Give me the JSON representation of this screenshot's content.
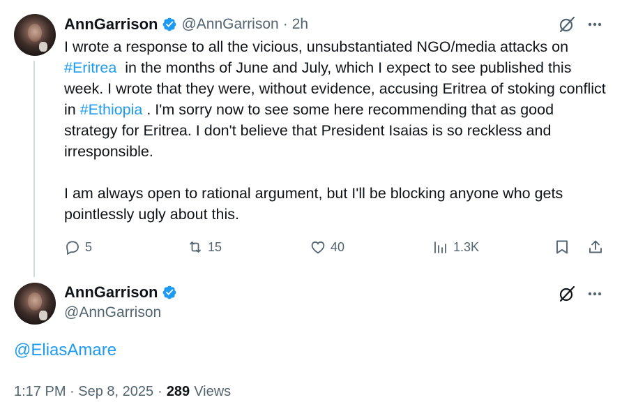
{
  "tweet1": {
    "display_name": "AnnGarrison",
    "handle": "@AnnGarrison",
    "separator": "·",
    "time_ago": "2h",
    "text_parts": {
      "p1": "I wrote a response to all the vicious, unsubstantiated NGO/media attacks on ",
      "tag1": "#Eritrea",
      "p2": "  in the months of June and July, which I expect to see published this week. I wrote that they were, without evidence, accusing Eritrea of stoking conflict in ",
      "tag2": "#Ethiopia",
      "p3": " . I'm sorry now to see some here recommending that as good strategy for Eritrea. I don't believe that President Isaias is so reckless and irresponsible.\n\nI am always open to rational argument, but I'll be blocking anyone who gets pointlessly ugly about this."
    },
    "actions": {
      "replies": "5",
      "reposts": "15",
      "likes": "40",
      "views": "1.3K"
    }
  },
  "tweet2": {
    "display_name": "AnnGarrison",
    "handle": "@AnnGarrison",
    "text": "@EliasAmare",
    "timestamp": "1:17 PM · Sep 8, 2025",
    "separator": "·",
    "views_count": "289",
    "views_label": "Views"
  },
  "icons": {
    "verified": "verified-badge-icon",
    "grok": "grok-icon",
    "more": "more-icon",
    "reply": "reply-icon",
    "repost": "repost-icon",
    "like": "like-icon",
    "views": "views-icon",
    "bookmark": "bookmark-icon",
    "share": "share-icon"
  },
  "colors": {
    "link": "#1d9bf0",
    "muted": "#536471",
    "text": "#0f1419",
    "verified": "#1d9bf0",
    "thread_line": "#cfd9de"
  }
}
